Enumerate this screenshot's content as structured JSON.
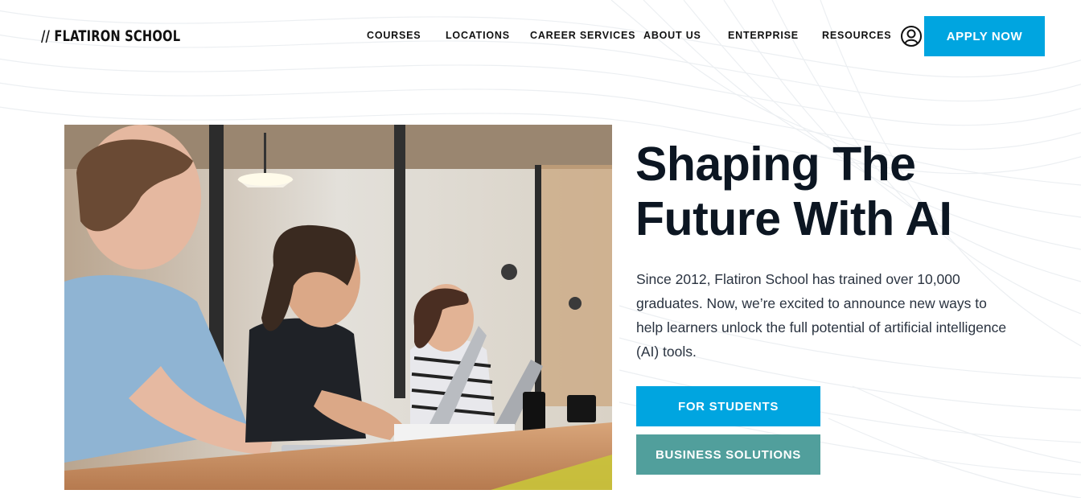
{
  "header": {
    "logo": "// FLATIRON SCHOOL",
    "nav": [
      {
        "label": "COURSES"
      },
      {
        "label": "LOCATIONS"
      },
      {
        "label": "CAREER SERVICES"
      },
      {
        "label": "ABOUT US"
      },
      {
        "label": "ENTERPRISE"
      },
      {
        "label": "RESOURCES"
      }
    ],
    "account_icon": "user-circle-icon",
    "apply_label": "APPLY NOW"
  },
  "hero": {
    "title_line1": "Shaping The",
    "title_line2": "Future With AI",
    "description": "Since 2012, Flatiron School has trained over 10,000 graduates. Now, we’re excited to announce new ways to help learners unlock the full potential of artificial intelligence (AI) tools.",
    "students_label": "FOR STUDENTS",
    "business_label": "BUSINESS SOLUTIONS"
  },
  "colors": {
    "accent_blue": "#00a5e0",
    "accent_teal": "#519f9c",
    "heading": "#0c1622"
  }
}
